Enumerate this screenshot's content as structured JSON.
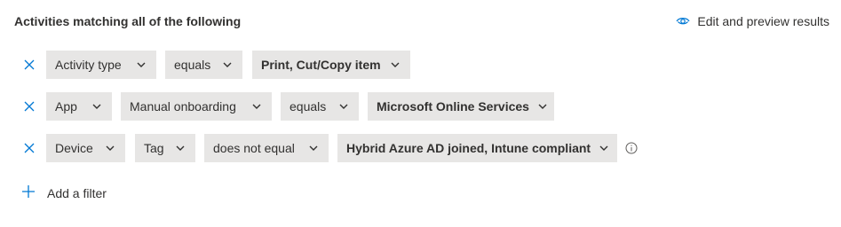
{
  "header": {
    "title": "Activities matching all of the following",
    "edit_preview_label": "Edit and preview results",
    "edit_preview_icon": "eye-icon"
  },
  "filters": [
    {
      "parts": [
        {
          "label": "Activity type",
          "bold": false
        },
        {
          "label": "equals",
          "bold": false
        },
        {
          "label": "Print, Cut/Copy item",
          "bold": true
        }
      ]
    },
    {
      "parts": [
        {
          "label": "App",
          "bold": false
        },
        {
          "label": "Manual onboarding",
          "bold": false
        },
        {
          "label": "equals",
          "bold": false
        },
        {
          "label": "Microsoft Online Services",
          "bold": true
        }
      ]
    },
    {
      "parts": [
        {
          "label": "Device",
          "bold": false
        },
        {
          "label": "Tag",
          "bold": false
        },
        {
          "label": "does not equal",
          "bold": false
        },
        {
          "label": "Hybrid Azure AD joined, Intune compliant",
          "bold": true
        }
      ],
      "info_icon": "info-icon"
    }
  ],
  "add_filter_label": "Add a filter",
  "colors": {
    "accent": "#0078d4",
    "dropdown_bg": "#e7e6e5",
    "text": "#323130"
  }
}
